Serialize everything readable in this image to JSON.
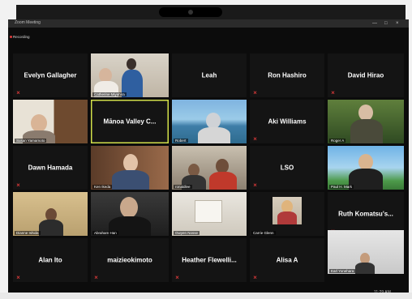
{
  "window": {
    "title": "Zoom Meeting",
    "controls": {
      "minimize": "—",
      "maximize": "□",
      "close": "×"
    }
  },
  "recording_label": "Recording",
  "clock": "11:29 AM",
  "participants": [
    {
      "name": "Evelyn Gallagher",
      "video": false,
      "muted": true
    },
    {
      "name": "Catherine Miyahira",
      "video": true,
      "muted": true
    },
    {
      "name": "Leah",
      "video": false,
      "muted": false
    },
    {
      "name": "Ron Hashiro",
      "video": false,
      "muted": true
    },
    {
      "name": "David Hirao",
      "video": false,
      "muted": true
    },
    {
      "name": "Susan Yamamoto",
      "video": true,
      "muted": true
    },
    {
      "name": "Mānoa Valley C...",
      "video": false,
      "muted": false,
      "active_speaker": true
    },
    {
      "name": "Robert",
      "video": true,
      "muted": true
    },
    {
      "name": "Aki Williams",
      "video": false,
      "muted": true
    },
    {
      "name": "Roger A",
      "video": true,
      "muted": true
    },
    {
      "name": "Dawn Hamada",
      "video": false,
      "muted": true
    },
    {
      "name": "Ken Ikeda",
      "video": true,
      "muted": true
    },
    {
      "name": "ronaldlee",
      "video": true,
      "muted": true
    },
    {
      "name": "LSO",
      "video": false,
      "muted": true
    },
    {
      "name": "Paul H. Mark",
      "video": true,
      "muted": true
    },
    {
      "name": "Dianne Ishida",
      "video": true,
      "muted": true
    },
    {
      "name": "Abraham Han",
      "video": true,
      "muted": true
    },
    {
      "name": "Gwyen Nosse",
      "video": true,
      "muted": true
    },
    {
      "name": "Carrie Glenn",
      "video": true,
      "muted": true
    },
    {
      "name": "Ruth Komatsu's...",
      "video": false,
      "muted": true
    },
    {
      "name": "Alan Ito",
      "video": false,
      "muted": true
    },
    {
      "name": "maizieokimoto",
      "video": false,
      "muted": true
    },
    {
      "name": "Heather Flewelli...",
      "video": false,
      "muted": true
    },
    {
      "name": "Alisa A",
      "video": false,
      "muted": true
    },
    {
      "name": "Earl Yonehara",
      "video": true,
      "muted": true
    }
  ],
  "colors": {
    "tile_background": "#141414",
    "active_speaker_border": "#d2e04a",
    "mute_icon": "#e23b3b"
  }
}
